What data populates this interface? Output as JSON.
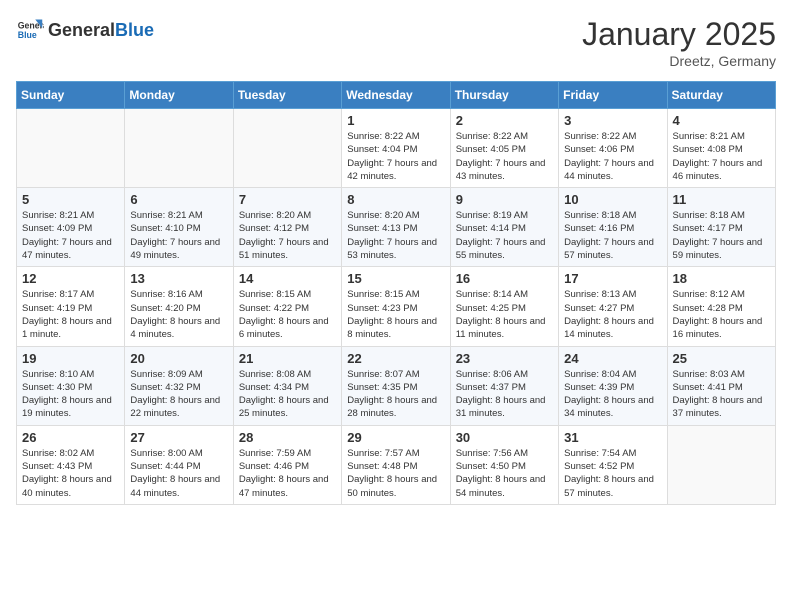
{
  "header": {
    "logo_general": "General",
    "logo_blue": "Blue",
    "month_title": "January 2025",
    "location": "Dreetz, Germany"
  },
  "days_of_week": [
    "Sunday",
    "Monday",
    "Tuesday",
    "Wednesday",
    "Thursday",
    "Friday",
    "Saturday"
  ],
  "weeks": [
    [
      {
        "day": "",
        "info": ""
      },
      {
        "day": "",
        "info": ""
      },
      {
        "day": "",
        "info": ""
      },
      {
        "day": "1",
        "info": "Sunrise: 8:22 AM\nSunset: 4:04 PM\nDaylight: 7 hours and 42 minutes."
      },
      {
        "day": "2",
        "info": "Sunrise: 8:22 AM\nSunset: 4:05 PM\nDaylight: 7 hours and 43 minutes."
      },
      {
        "day": "3",
        "info": "Sunrise: 8:22 AM\nSunset: 4:06 PM\nDaylight: 7 hours and 44 minutes."
      },
      {
        "day": "4",
        "info": "Sunrise: 8:21 AM\nSunset: 4:08 PM\nDaylight: 7 hours and 46 minutes."
      }
    ],
    [
      {
        "day": "5",
        "info": "Sunrise: 8:21 AM\nSunset: 4:09 PM\nDaylight: 7 hours and 47 minutes."
      },
      {
        "day": "6",
        "info": "Sunrise: 8:21 AM\nSunset: 4:10 PM\nDaylight: 7 hours and 49 minutes."
      },
      {
        "day": "7",
        "info": "Sunrise: 8:20 AM\nSunset: 4:12 PM\nDaylight: 7 hours and 51 minutes."
      },
      {
        "day": "8",
        "info": "Sunrise: 8:20 AM\nSunset: 4:13 PM\nDaylight: 7 hours and 53 minutes."
      },
      {
        "day": "9",
        "info": "Sunrise: 8:19 AM\nSunset: 4:14 PM\nDaylight: 7 hours and 55 minutes."
      },
      {
        "day": "10",
        "info": "Sunrise: 8:18 AM\nSunset: 4:16 PM\nDaylight: 7 hours and 57 minutes."
      },
      {
        "day": "11",
        "info": "Sunrise: 8:18 AM\nSunset: 4:17 PM\nDaylight: 7 hours and 59 minutes."
      }
    ],
    [
      {
        "day": "12",
        "info": "Sunrise: 8:17 AM\nSunset: 4:19 PM\nDaylight: 8 hours and 1 minute."
      },
      {
        "day": "13",
        "info": "Sunrise: 8:16 AM\nSunset: 4:20 PM\nDaylight: 8 hours and 4 minutes."
      },
      {
        "day": "14",
        "info": "Sunrise: 8:15 AM\nSunset: 4:22 PM\nDaylight: 8 hours and 6 minutes."
      },
      {
        "day": "15",
        "info": "Sunrise: 8:15 AM\nSunset: 4:23 PM\nDaylight: 8 hours and 8 minutes."
      },
      {
        "day": "16",
        "info": "Sunrise: 8:14 AM\nSunset: 4:25 PM\nDaylight: 8 hours and 11 minutes."
      },
      {
        "day": "17",
        "info": "Sunrise: 8:13 AM\nSunset: 4:27 PM\nDaylight: 8 hours and 14 minutes."
      },
      {
        "day": "18",
        "info": "Sunrise: 8:12 AM\nSunset: 4:28 PM\nDaylight: 8 hours and 16 minutes."
      }
    ],
    [
      {
        "day": "19",
        "info": "Sunrise: 8:10 AM\nSunset: 4:30 PM\nDaylight: 8 hours and 19 minutes."
      },
      {
        "day": "20",
        "info": "Sunrise: 8:09 AM\nSunset: 4:32 PM\nDaylight: 8 hours and 22 minutes."
      },
      {
        "day": "21",
        "info": "Sunrise: 8:08 AM\nSunset: 4:34 PM\nDaylight: 8 hours and 25 minutes."
      },
      {
        "day": "22",
        "info": "Sunrise: 8:07 AM\nSunset: 4:35 PM\nDaylight: 8 hours and 28 minutes."
      },
      {
        "day": "23",
        "info": "Sunrise: 8:06 AM\nSunset: 4:37 PM\nDaylight: 8 hours and 31 minutes."
      },
      {
        "day": "24",
        "info": "Sunrise: 8:04 AM\nSunset: 4:39 PM\nDaylight: 8 hours and 34 minutes."
      },
      {
        "day": "25",
        "info": "Sunrise: 8:03 AM\nSunset: 4:41 PM\nDaylight: 8 hours and 37 minutes."
      }
    ],
    [
      {
        "day": "26",
        "info": "Sunrise: 8:02 AM\nSunset: 4:43 PM\nDaylight: 8 hours and 40 minutes."
      },
      {
        "day": "27",
        "info": "Sunrise: 8:00 AM\nSunset: 4:44 PM\nDaylight: 8 hours and 44 minutes."
      },
      {
        "day": "28",
        "info": "Sunrise: 7:59 AM\nSunset: 4:46 PM\nDaylight: 8 hours and 47 minutes."
      },
      {
        "day": "29",
        "info": "Sunrise: 7:57 AM\nSunset: 4:48 PM\nDaylight: 8 hours and 50 minutes."
      },
      {
        "day": "30",
        "info": "Sunrise: 7:56 AM\nSunset: 4:50 PM\nDaylight: 8 hours and 54 minutes."
      },
      {
        "day": "31",
        "info": "Sunrise: 7:54 AM\nSunset: 4:52 PM\nDaylight: 8 hours and 57 minutes."
      },
      {
        "day": "",
        "info": ""
      }
    ]
  ]
}
